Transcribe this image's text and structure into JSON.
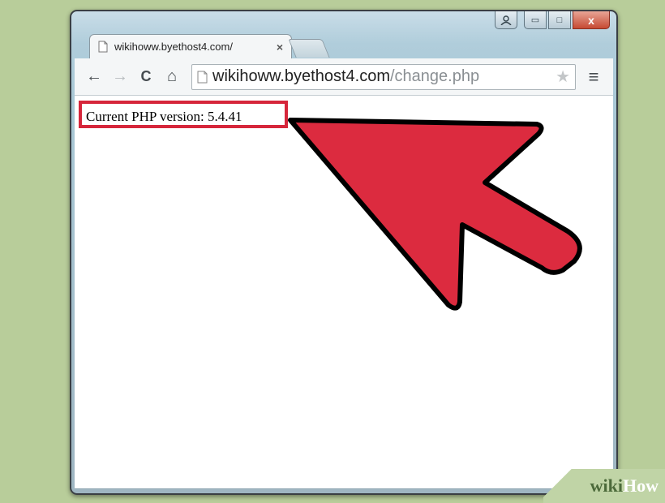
{
  "browser": {
    "tab": {
      "title": "wikihoww.byethost4.com/",
      "close_glyph": "×"
    },
    "toolbar": {
      "back_glyph": "←",
      "forward_glyph": "→",
      "reload_glyph": "C",
      "home_glyph": "⌂",
      "menu_glyph": "≡",
      "star_glyph": "★",
      "url_host": "wikihoww.byethost4.com",
      "url_path": "/change.php"
    },
    "window_controls": {
      "minimize_glyph": "▭",
      "maximize_glyph": "□",
      "close_glyph": "x"
    }
  },
  "page": {
    "php_version_text": "Current PHP version: 5.4.41"
  },
  "annotation": {
    "highlight_color": "#d6263b",
    "arrow_color": "#dc2b3f"
  },
  "watermark": {
    "wiki": "wiki",
    "how": "How"
  }
}
